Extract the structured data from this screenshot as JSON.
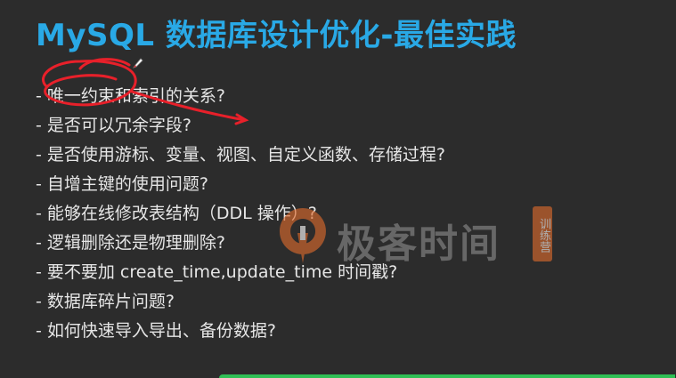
{
  "slide": {
    "title": "MySQL 数据库设计优化-最佳实践",
    "bullets": [
      "唯一约束和索引的关系?",
      "是否可以冗余字段?",
      "是否使用游标、变量、视图、自定义函数、存储过程?",
      "自增主键的使用问题?",
      "能够在线修改表结构（DDL 操作）?",
      "逻辑删除还是物理删除?",
      "要不要加 create_time,update_time 时间戳?",
      "数据库碎片问题?",
      "如何快速导入导出、备份数据?"
    ],
    "bullet_marker": "-"
  },
  "watermark": {
    "brand": "极客时间",
    "badge": "训练营"
  },
  "colors": {
    "title": "#29a9e6",
    "text": "#e6e6e6",
    "background": "#2c2c2c",
    "annotation": "#e8202a",
    "watermark_badge": "#e06b2d",
    "bottom_bar": "#2fbf55"
  },
  "icons": {
    "pen": "pen-icon",
    "logo": "geektime-logo-icon"
  }
}
